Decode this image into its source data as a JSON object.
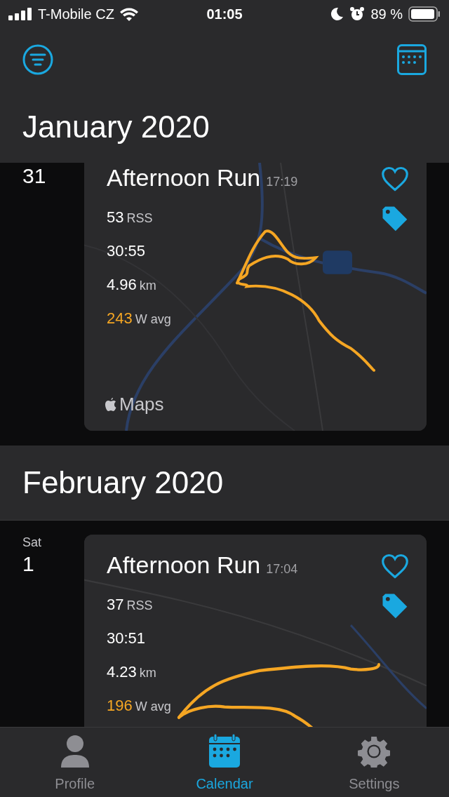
{
  "status_bar": {
    "carrier": "T-Mobile CZ",
    "time": "01:05",
    "battery": "89 %"
  },
  "sections": [
    {
      "month": "January 2020",
      "days": [
        {
          "day": "31",
          "activity": {
            "title": "Afternoon Run",
            "time": "17:19",
            "favorite": false,
            "map_credit": "Maps",
            "stats": [
              {
                "kind": "plain",
                "value": "53",
                "unit": "RSS"
              },
              {
                "kind": "plain",
                "value": "30:55"
              },
              {
                "kind": "plain",
                "value": "4.96",
                "unit": "km"
              },
              {
                "kind": "power",
                "value": "243",
                "unit": "W avg"
              }
            ]
          }
        }
      ]
    },
    {
      "month": "February 2020",
      "days": [
        {
          "weekday": "Sat",
          "day": "1",
          "activity": {
            "title": "Afternoon Run",
            "time": "17:04",
            "favorite": false,
            "stats": [
              {
                "kind": "plain",
                "value": "37",
                "unit": "RSS"
              },
              {
                "kind": "plain",
                "value": "30:51"
              },
              {
                "kind": "plain",
                "value": "4.23",
                "unit": "km"
              },
              {
                "kind": "power",
                "value": "196",
                "unit": "W avg"
              }
            ]
          }
        }
      ]
    }
  ],
  "tab_bar": [
    {
      "label": "Profile",
      "kind": "profile",
      "selected": false
    },
    {
      "label": "Calendar",
      "kind": "calendar",
      "selected": true
    },
    {
      "label": "Settings",
      "kind": "settings",
      "selected": false
    }
  ]
}
